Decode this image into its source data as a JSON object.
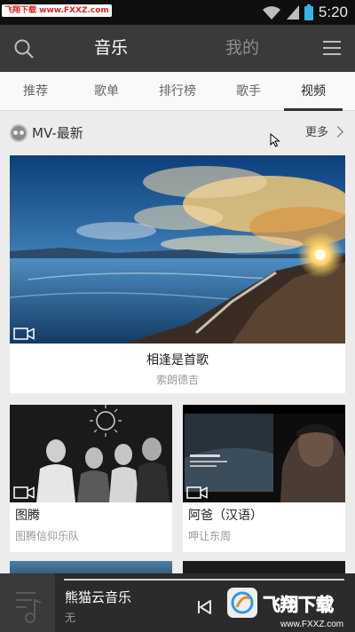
{
  "status_bar": {
    "watermark": "飞翔下载 www.FXXZ.com",
    "time": "5:20"
  },
  "header": {
    "music_title": "音乐",
    "mine_title": "我的"
  },
  "tabs": [
    {
      "label": "推荐"
    },
    {
      "label": "歌单"
    },
    {
      "label": "排行榜"
    },
    {
      "label": "歌手"
    },
    {
      "label": "视频"
    }
  ],
  "active_tab": "视频",
  "section": {
    "title": "MV-最新",
    "more_label": "更多"
  },
  "featured": {
    "title": "相逢是首歌",
    "artist": "索朗德吉"
  },
  "videos": [
    {
      "title": "图腾",
      "artist": "图腾信仰乐队"
    },
    {
      "title": "阿爸（汉语）",
      "artist": "呷让东周"
    }
  ],
  "player": {
    "song": "熊猫云音乐",
    "artist": "无"
  },
  "logo": {
    "text": "飞翔下载",
    "url": "www.FXXZ.com"
  },
  "colors": {
    "header_bg": "#3a3a3a",
    "statusbar_bg": "#0f0f0f",
    "tab_bg": "#f9f9f9",
    "player_bg": "#2b2b2b"
  }
}
